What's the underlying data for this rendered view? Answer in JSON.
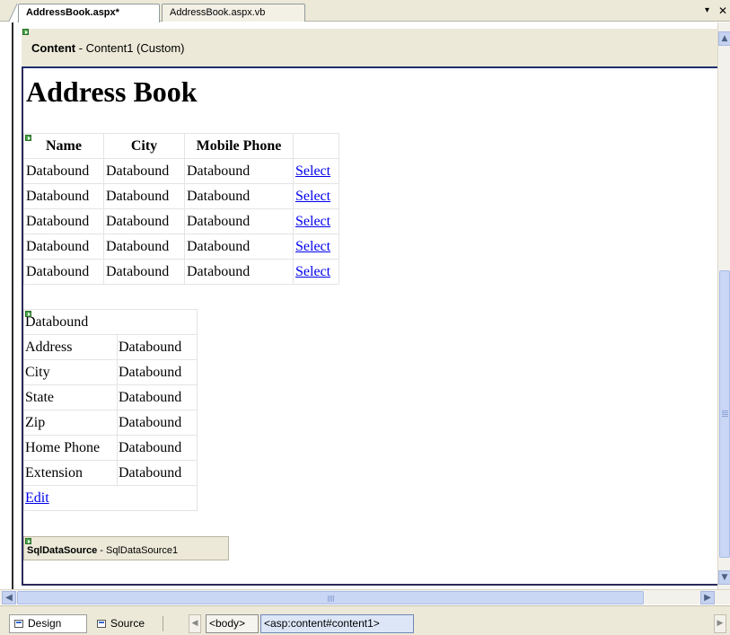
{
  "tabs": [
    {
      "label": "AddressBook.aspx*",
      "active": true
    },
    {
      "label": "AddressBook.aspx.vb",
      "active": false
    }
  ],
  "tab_controls": {
    "dropdown_glyph": "▾",
    "close_glyph": "✕"
  },
  "content_control": {
    "name": "Content",
    "rest": " - Content1 (Custom)"
  },
  "page_title": "Address Book",
  "grid": {
    "headers": [
      "Name",
      "City",
      "Mobile Phone",
      ""
    ],
    "rows": [
      [
        "Databound",
        "Databound",
        "Databound",
        "Select"
      ],
      [
        "Databound",
        "Databound",
        "Databound",
        "Select"
      ],
      [
        "Databound",
        "Databound",
        "Databound",
        "Select"
      ],
      [
        "Databound",
        "Databound",
        "Databound",
        "Select"
      ],
      [
        "Databound",
        "Databound",
        "Databound",
        "Select"
      ]
    ]
  },
  "details": {
    "header": "Databound",
    "rows": [
      {
        "label": "Address",
        "value": "Databound"
      },
      {
        "label": "City",
        "value": "Databound"
      },
      {
        "label": "State",
        "value": "Databound"
      },
      {
        "label": "Zip",
        "value": "Databound"
      },
      {
        "label": "Home Phone",
        "value": "Databound"
      },
      {
        "label": "Extension",
        "value": "Databound"
      }
    ],
    "edit_link": "Edit"
  },
  "sql_datasource": {
    "type": "SqlDataSource",
    "rest": " - SqlDataSource1"
  },
  "view_tabs": {
    "design": "Design",
    "source": "Source"
  },
  "breadcrumbs": [
    "<body>",
    "<asp:content#content1>"
  ],
  "icons": {
    "design": "design-view-icon",
    "source": "source-view-icon",
    "smart_tag": "smart-tag-glyph-icon"
  },
  "colors": {
    "link": "#0000ee",
    "chrome": "#ece9d8",
    "scrollbar": "#c9d6f4"
  }
}
